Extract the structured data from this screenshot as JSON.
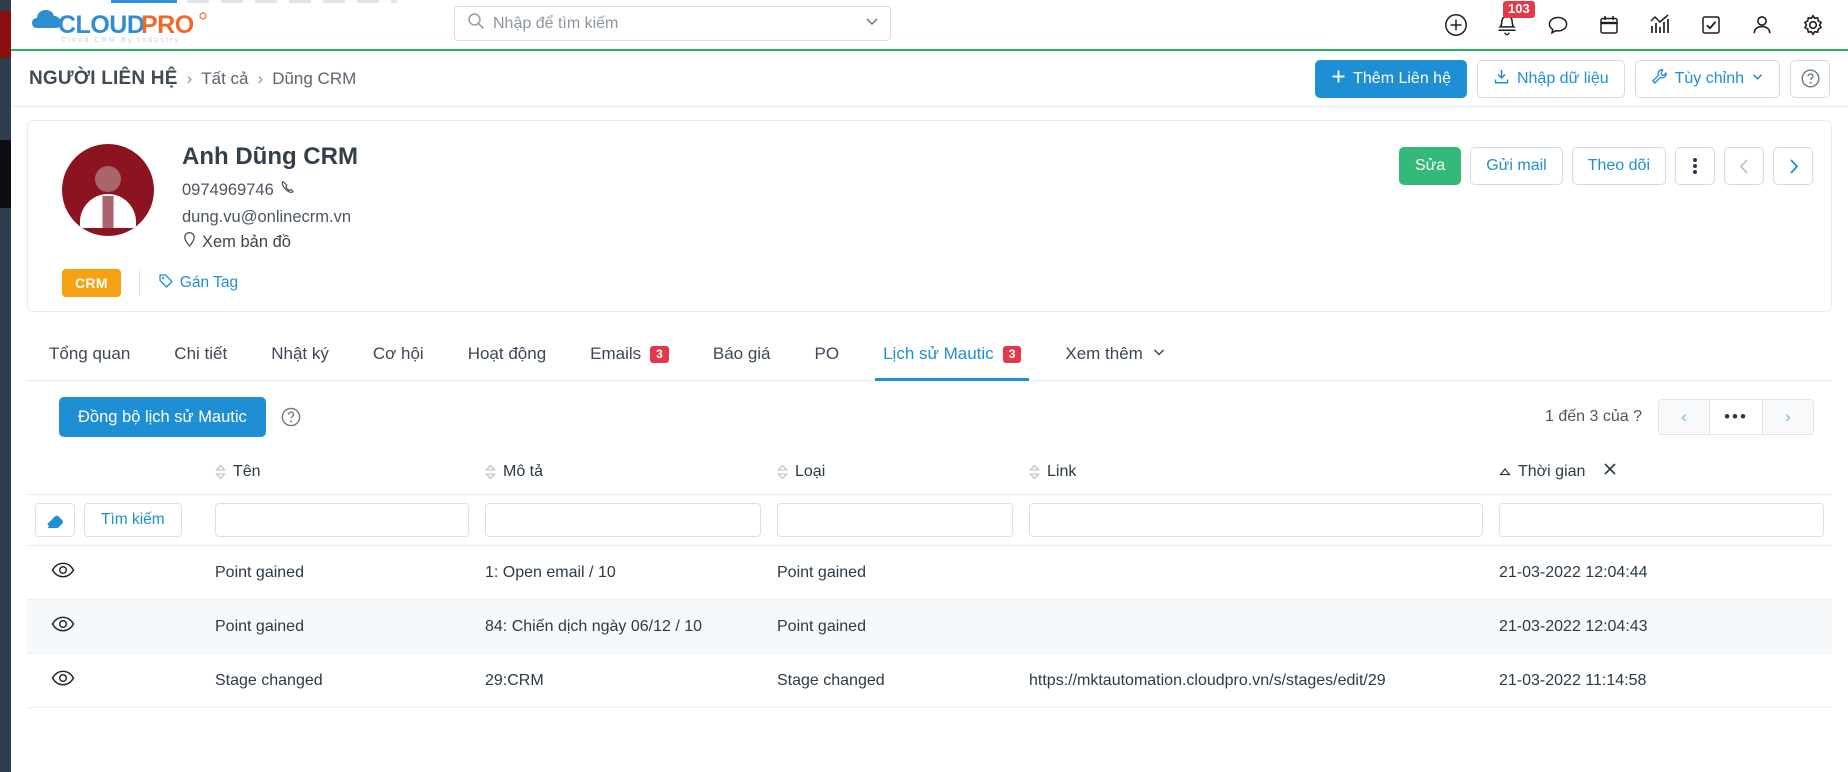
{
  "brand": {
    "logo_main": "CLOUD",
    "logo_accent": "PRO",
    "tagline": "Cloud CRM By Industry",
    "blue": "#1e8fd5",
    "orange": "#ee6a2a",
    "green": "#2eae63",
    "red": "#e23a48"
  },
  "search": {
    "placeholder": "Nhập để tìm kiếm",
    "value": ""
  },
  "topbar": {
    "icons": [
      {
        "name": "plus-circle-icon"
      },
      {
        "name": "bell-icon",
        "badge": "103"
      },
      {
        "name": "chat-icon"
      },
      {
        "name": "calendar-icon"
      },
      {
        "name": "analytics-icon"
      },
      {
        "name": "task-check-icon"
      },
      {
        "name": "user-icon"
      },
      {
        "name": "gear-icon"
      }
    ]
  },
  "breadcrumb": {
    "title": "NGƯỜI LIÊN HỆ",
    "separator": "›",
    "items": [
      {
        "label": "Tất cả"
      },
      {
        "label": "Dũng CRM"
      }
    ],
    "actions": {
      "add": "Thêm Liên hệ",
      "import": "Nhập dữ liệu",
      "customize": "Tùy chỉnh",
      "help": "?"
    }
  },
  "contact": {
    "name": "Anh Dũng CRM",
    "phone": "0974969746",
    "email": "dung.vu@onlinecrm.vn",
    "map_link": "Xem bản đồ",
    "tag": "CRM",
    "add_tag": "Gán Tag",
    "actions": {
      "edit": "Sửa",
      "send_mail": "Gửi mail",
      "follow": "Theo dõi",
      "more": "⋮",
      "prev": "‹",
      "next": "›"
    }
  },
  "tabs": [
    {
      "label": "Tổng quan",
      "badge": "",
      "active": false
    },
    {
      "label": "Chi tiết",
      "badge": "",
      "active": false
    },
    {
      "label": "Nhật ký",
      "badge": "",
      "active": false
    },
    {
      "label": "Cơ hội",
      "badge": "",
      "active": false
    },
    {
      "label": "Hoạt động",
      "badge": "",
      "active": false
    },
    {
      "label": "Emails",
      "badge": "3",
      "active": false
    },
    {
      "label": "Báo giá",
      "badge": "",
      "active": false
    },
    {
      "label": "PO",
      "badge": "",
      "active": false
    },
    {
      "label": "Lịch sử Mautic",
      "badge": "3",
      "active": true
    },
    {
      "label": "Xem thêm",
      "badge": "",
      "active": false
    }
  ],
  "toolbar": {
    "sync_label": "Đồng bộ lịch sử Mautic",
    "help": "?",
    "pager_text": "1 đến 3 của ?",
    "pager_prev": "‹",
    "pager_mid": "•••",
    "pager_next": "›"
  },
  "table": {
    "columns": [
      {
        "key": "eye",
        "label": ""
      },
      {
        "key": "name",
        "label": "Tên",
        "sorted": "none"
      },
      {
        "key": "desc",
        "label": "Mô tả",
        "sorted": "none"
      },
      {
        "key": "type",
        "label": "Loại",
        "sorted": "none"
      },
      {
        "key": "link",
        "label": "Link",
        "sorted": "none"
      },
      {
        "key": "time",
        "label": "Thời gian",
        "sorted": "asc"
      }
    ],
    "filters": {
      "clear_label": "",
      "search_label": "Tìm kiếm",
      "name": "",
      "desc": "",
      "type": "",
      "link": "",
      "time": ""
    },
    "rows": [
      {
        "name": "Point gained",
        "desc": "1: Open email / 10",
        "type": "Point gained",
        "link": "",
        "time": "21-03-2022 12:04:44"
      },
      {
        "name": "Point gained",
        "desc": "84: Chiến dịch ngày 06/12 / 10",
        "type": "Point gained",
        "link": "",
        "time": "21-03-2022 12:04:43"
      },
      {
        "name": "Stage changed",
        "desc": "29:CRM",
        "type": "Stage changed",
        "link": "https://mktautomation.cloudpro.vn/s/stages/edit/29",
        "time": "21-03-2022 11:14:58"
      }
    ]
  }
}
